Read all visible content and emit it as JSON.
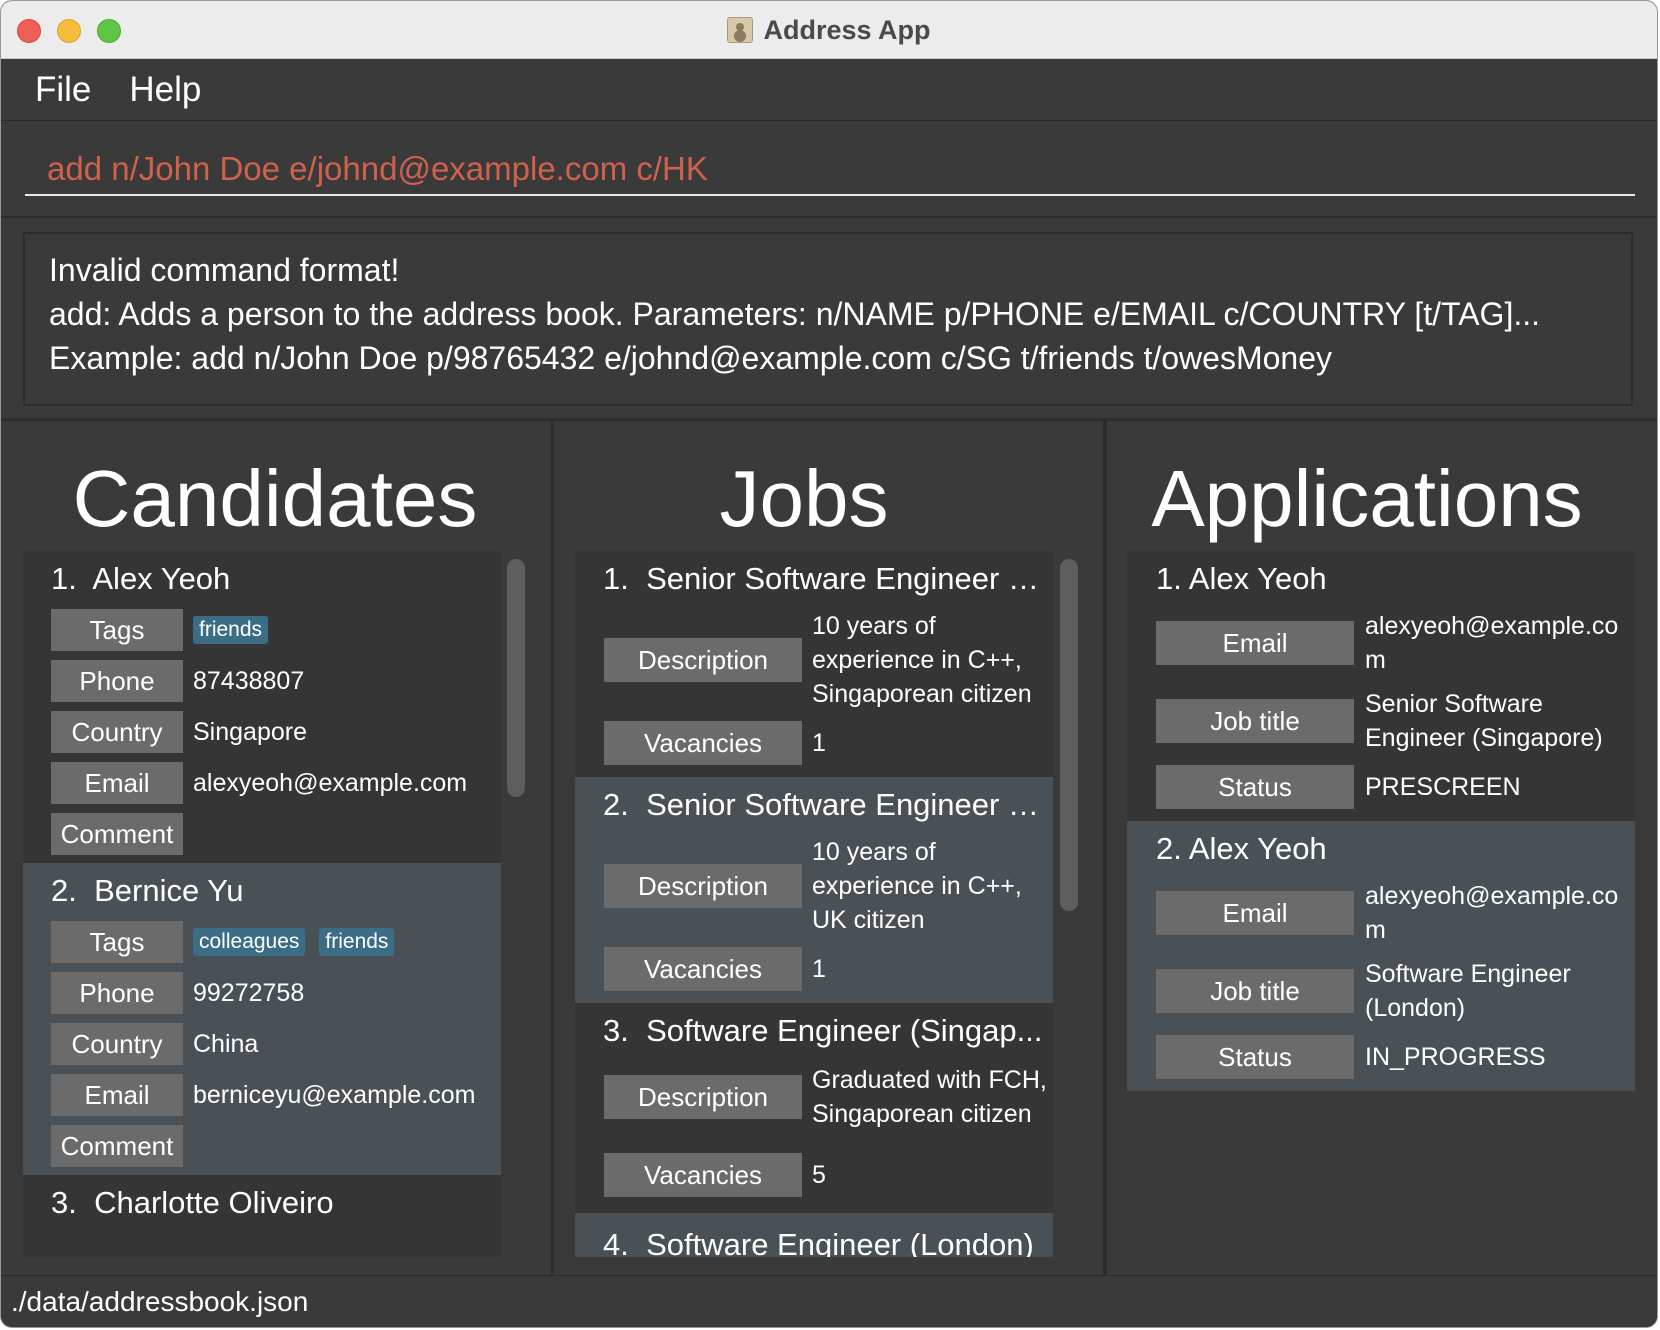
{
  "window": {
    "title": "Address App",
    "colors": {
      "background": "#3b3b3b",
      "card_alt": "#4a5156",
      "label_bg": "#6b6b6b",
      "tag_bg": "#3c6d87",
      "command_text": "#d0614c"
    }
  },
  "menu": {
    "items": [
      "File",
      "Help"
    ]
  },
  "command": {
    "value": "add n/John Doe e/johnd@example.com c/HK"
  },
  "result": {
    "lines": [
      "Invalid command format!",
      "add: Adds a person to the address book. Parameters: n/NAME p/PHONE e/EMAIL c/COUNTRY [t/TAG]...",
      "Example: add n/John Doe p/98765432 e/johnd@example.com c/SG t/friends t/owesMoney"
    ]
  },
  "candidates": {
    "title": "Candidates",
    "labels": {
      "tags": "Tags",
      "phone": "Phone",
      "country": "Country",
      "email": "Email",
      "comment": "Comment"
    },
    "items": [
      {
        "index": "1.",
        "name": "Alex Yeoh",
        "tags": [
          "friends"
        ],
        "phone": "87438807",
        "country": "Singapore",
        "email": "alexyeoh@example.com"
      },
      {
        "index": "2.",
        "name": "Bernice Yu",
        "tags": [
          "colleagues",
          "friends"
        ],
        "phone": "99272758",
        "country": "China",
        "email": "berniceyu@example.com"
      },
      {
        "index": "3.",
        "name": "Charlotte Oliveiro"
      }
    ]
  },
  "jobs": {
    "title": "Jobs",
    "labels": {
      "description": "Description",
      "vacancies": "Vacancies"
    },
    "items": [
      {
        "index": "1.",
        "title": "Senior Software Engineer (S...",
        "description": [
          "10 years of",
          "experience in C++,",
          "Singaporean citizen"
        ],
        "vacancies": "1"
      },
      {
        "index": "2.",
        "title": "Senior Software Engineer (L...",
        "description": [
          "10 years of",
          "experience in C++,",
          "UK citizen"
        ],
        "vacancies": "1"
      },
      {
        "index": "3.",
        "title": "Software Engineer (Singap...",
        "description": [
          "Graduated with FCH,",
          "Singaporean citizen"
        ],
        "vacancies": "5"
      },
      {
        "index": "4.",
        "title": "Software Engineer (London)"
      }
    ]
  },
  "applications": {
    "title": "Applications",
    "labels": {
      "email": "Email",
      "job_title": "Job title",
      "status": "Status"
    },
    "items": [
      {
        "index": "1.",
        "name": "Alex Yeoh",
        "email": [
          "alexyeoh@example.co",
          "m"
        ],
        "job_title": [
          "Senior Software",
          "Engineer (Singapore)"
        ],
        "status": "PRESCREEN"
      },
      {
        "index": "2.",
        "name": "Alex Yeoh",
        "email": [
          "alexyeoh@example.co",
          "m"
        ],
        "job_title": [
          "Software Engineer",
          "(London)"
        ],
        "status": "IN_PROGRESS"
      }
    ]
  },
  "status_bar": {
    "path": "./data/addressbook.json"
  }
}
